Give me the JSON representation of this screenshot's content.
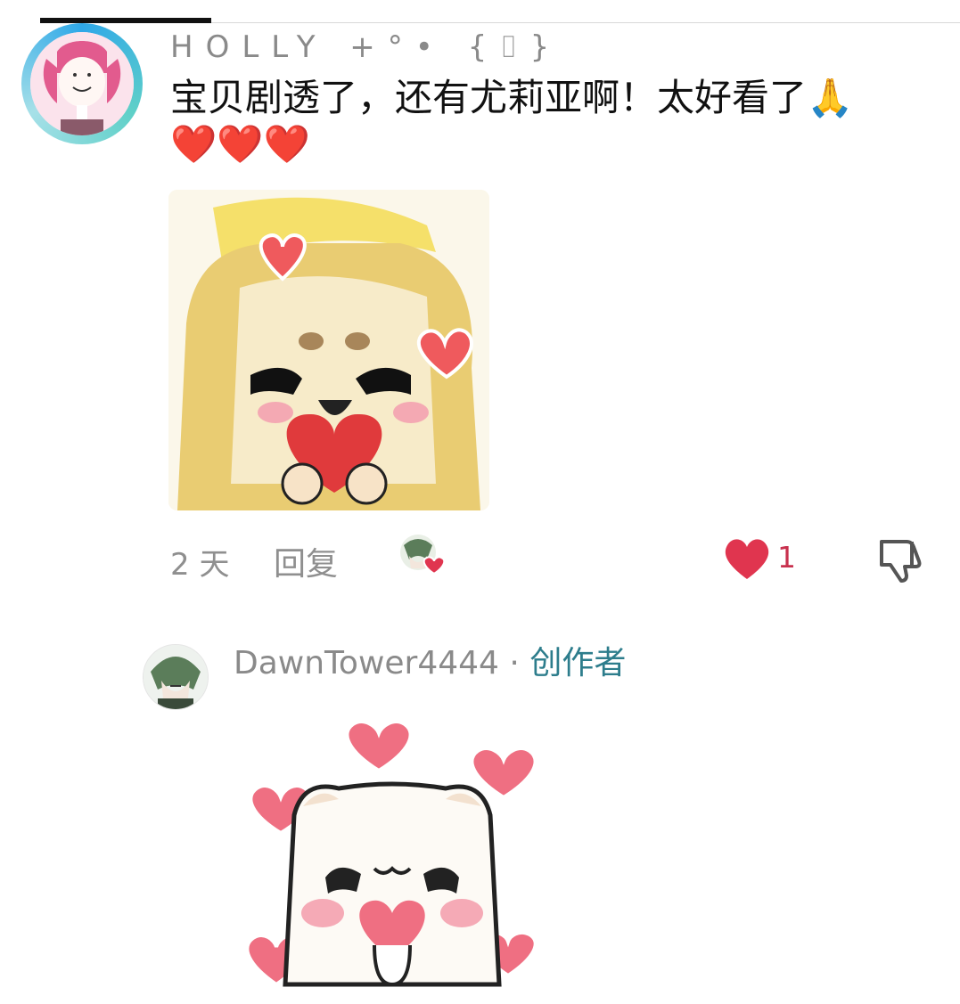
{
  "comment": {
    "username": "HOLLY +°• {⌷}",
    "text": "宝贝剧透了，还有尤莉亚啊！太好看了🙏",
    "text_line2": "❤️❤️❤️",
    "time": "2 天",
    "reply_label": "回复",
    "like_count": "1",
    "colors": {
      "like_red": "#e0354f",
      "creator_teal": "#2d7d8c"
    }
  },
  "reply": {
    "username": "DawnTower4444",
    "separator": "·",
    "badge": "创作者"
  }
}
